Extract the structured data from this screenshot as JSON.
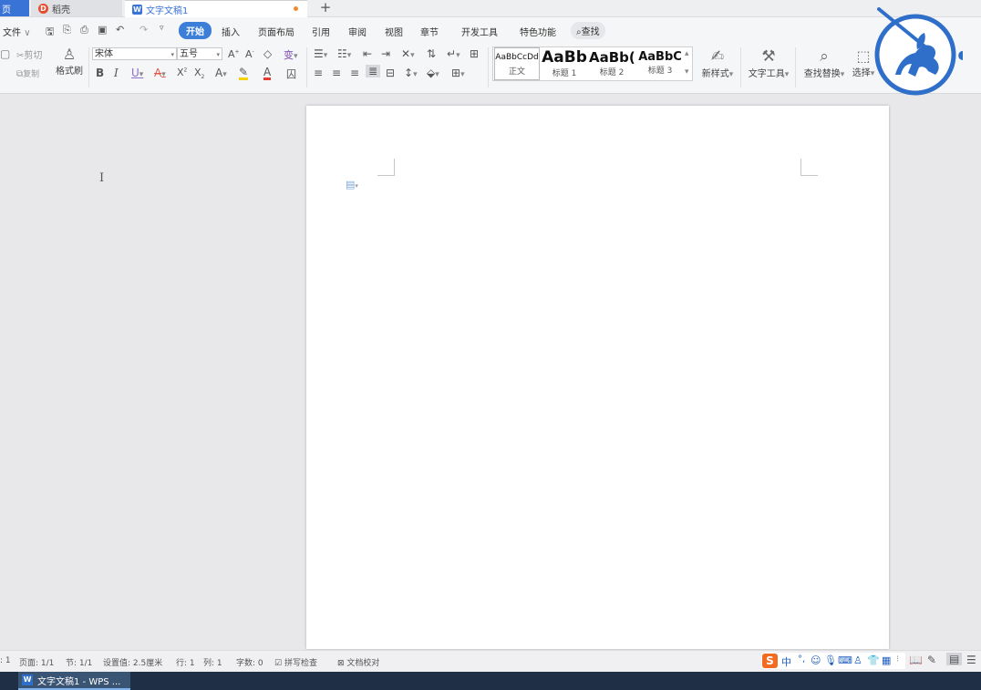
{
  "tabs": {
    "home": "页",
    "daoke": "稻壳",
    "doc": "文字文稿1",
    "add": "+"
  },
  "menubar": {
    "file": "文件",
    "items": [
      "开始",
      "插入",
      "页面布局",
      "引用",
      "审阅",
      "视图",
      "章节",
      "开发工具",
      "特色功能"
    ],
    "search": "查找"
  },
  "ribbon": {
    "cut": "剪切",
    "copy": "复制",
    "format_painter": "格式刷",
    "font_name": "宋体",
    "font_size": "五号",
    "new_style": "新样式",
    "text_tools": "文字工具",
    "find_replace": "查找替换",
    "select": "选择",
    "styles": [
      {
        "preview": "AaBbCcDd",
        "name": "正文"
      },
      {
        "preview": "AaBb",
        "name": "标题 1"
      },
      {
        "preview": "AaBb(",
        "name": "标题 2"
      },
      {
        "preview": "AaBbC",
        "name": "标题 3"
      }
    ]
  },
  "statusbar": {
    "page_num_prefix": ": 1",
    "pages": "页面: 1/1",
    "section": "节: 1/1",
    "setting": "设置值: 2.5厘米",
    "row": "行: 1",
    "col": "列: 1",
    "word_count": "字数: 0",
    "spell_check": "拼写检查",
    "doc_proof": "文档校对"
  },
  "taskbar": {
    "item": "文字文稿1 - WPS ..."
  },
  "colors": {
    "accent": "#3c7fd8",
    "logo_blue": "#2f6fc9"
  }
}
